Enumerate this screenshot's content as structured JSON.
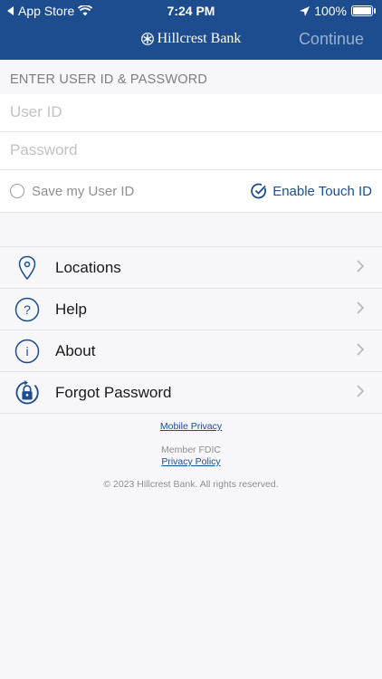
{
  "status_bar": {
    "carrier": "App Store",
    "time": "7:24 PM",
    "battery": "100%"
  },
  "header": {
    "brand": "Hillcrest Bank",
    "continue_label": "Continue"
  },
  "login": {
    "section_label": "ENTER USER ID & PASSWORD",
    "user_id_placeholder": "User ID",
    "password_placeholder": "Password",
    "save_user_id_label": "Save my User ID",
    "touch_id_label": "Enable Touch ID"
  },
  "menu": {
    "items": [
      {
        "label": "Locations",
        "icon": "location-pin-icon"
      },
      {
        "label": "Help",
        "icon": "question-icon"
      },
      {
        "label": "About",
        "icon": "info-icon"
      },
      {
        "label": "Forgot Password",
        "icon": "lock-refresh-icon"
      }
    ]
  },
  "footer": {
    "mobile_privacy": "Mobile Privacy",
    "member_fdic": "Member FDIC",
    "privacy_policy": "Privacy Policy",
    "copyright": "© 2023 Hillcrest Bank. All rights reserved."
  },
  "colors": {
    "brand_blue": "#1d4d8f",
    "background": "#f7f6f8"
  }
}
